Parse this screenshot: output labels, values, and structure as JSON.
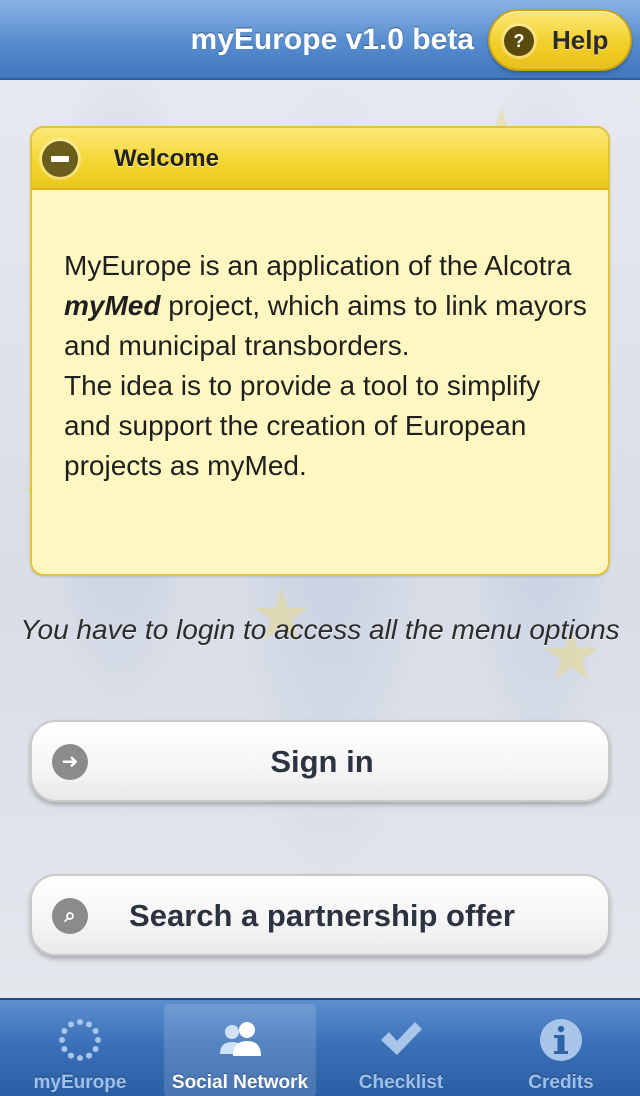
{
  "header": {
    "title": "myEurope v1.0 beta",
    "help_label": "Help",
    "help_icon": "question-icon"
  },
  "welcome": {
    "title": "Welcome",
    "body_part1": "MyEurope is an application of the Alcotra ",
    "body_emphasis": "myMed",
    "body_part2": " project, which aims to link mayors and municipal transborders.",
    "body_part3": "The idea is to provide a tool to simplify and support the creation of European projects as myMed."
  },
  "login_note": "You have to login to access all the menu options",
  "buttons": {
    "sign_in": "Sign in",
    "search": "Search a partnership offer"
  },
  "tabs": [
    {
      "label": "myEurope",
      "icon": "eu-stars-icon",
      "active": false
    },
    {
      "label": "Social Network",
      "icon": "people-icon",
      "active": true
    },
    {
      "label": "Checklist",
      "icon": "checkmark-icon",
      "active": false
    },
    {
      "label": "Credits",
      "icon": "info-icon",
      "active": false
    }
  ],
  "colors": {
    "header_blue": "#4a80c6",
    "accent_yellow": "#f2cf2b",
    "card_bg": "#fff7c2"
  }
}
